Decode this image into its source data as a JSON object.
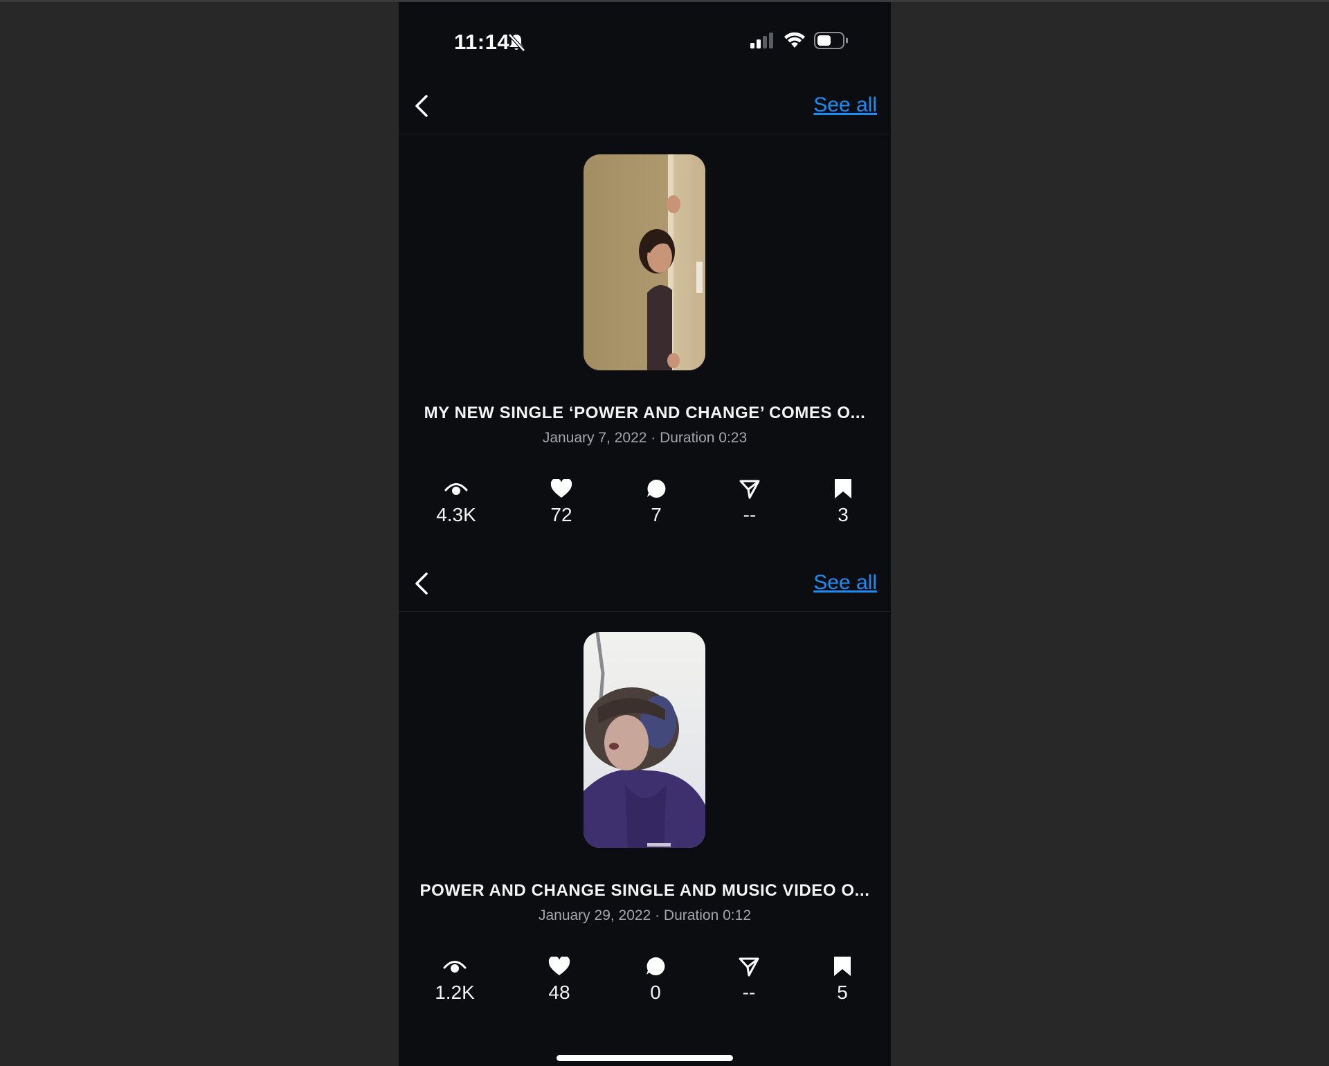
{
  "status_bar": {
    "time": "11:14"
  },
  "sections": [
    {
      "see_all_label": "See all",
      "title": "MY NEW SINGLE ‘POWER AND CHANGE’ COMES O...",
      "meta": "January 7, 2022 · Duration 0:23",
      "stats": {
        "views": "4.3K",
        "likes": "72",
        "comments": "7",
        "shares": "--",
        "saves": "3"
      }
    },
    {
      "see_all_label": "See all",
      "title": "POWER AND CHANGE SINGLE AND MUSIC VIDEO O...",
      "meta": "January 29, 2022 · Duration 0:12",
      "stats": {
        "views": "1.2K",
        "likes": "48",
        "comments": "0",
        "shares": "--",
        "saves": "5"
      }
    }
  ],
  "icons": [
    "back-icon",
    "eye-icon",
    "heart-icon",
    "comment-icon",
    "share-icon",
    "bookmark-icon",
    "bell-slash-icon",
    "signal-icon",
    "wifi-icon",
    "battery-icon"
  ],
  "colors": {
    "background": "#0b0d11",
    "link": "#1a8cf5",
    "meta_text": "#a3a7ad"
  }
}
